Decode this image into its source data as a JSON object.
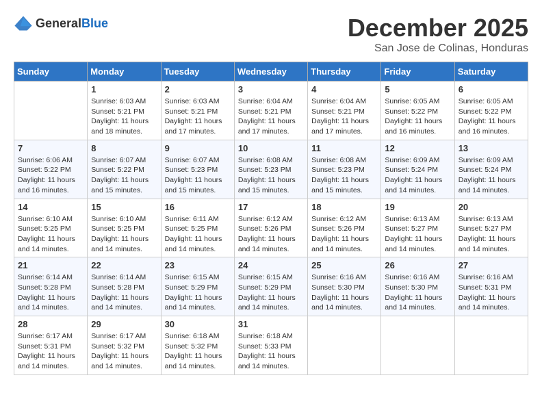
{
  "logo": {
    "general": "General",
    "blue": "Blue"
  },
  "title": "December 2025",
  "location": "San Jose de Colinas, Honduras",
  "days_of_week": [
    "Sunday",
    "Monday",
    "Tuesday",
    "Wednesday",
    "Thursday",
    "Friday",
    "Saturday"
  ],
  "weeks": [
    [
      {
        "day": "",
        "sunrise": "",
        "sunset": "",
        "daylight": ""
      },
      {
        "day": "1",
        "sunrise": "Sunrise: 6:03 AM",
        "sunset": "Sunset: 5:21 PM",
        "daylight": "Daylight: 11 hours and 18 minutes."
      },
      {
        "day": "2",
        "sunrise": "Sunrise: 6:03 AM",
        "sunset": "Sunset: 5:21 PM",
        "daylight": "Daylight: 11 hours and 17 minutes."
      },
      {
        "day": "3",
        "sunrise": "Sunrise: 6:04 AM",
        "sunset": "Sunset: 5:21 PM",
        "daylight": "Daylight: 11 hours and 17 minutes."
      },
      {
        "day": "4",
        "sunrise": "Sunrise: 6:04 AM",
        "sunset": "Sunset: 5:21 PM",
        "daylight": "Daylight: 11 hours and 17 minutes."
      },
      {
        "day": "5",
        "sunrise": "Sunrise: 6:05 AM",
        "sunset": "Sunset: 5:22 PM",
        "daylight": "Daylight: 11 hours and 16 minutes."
      },
      {
        "day": "6",
        "sunrise": "Sunrise: 6:05 AM",
        "sunset": "Sunset: 5:22 PM",
        "daylight": "Daylight: 11 hours and 16 minutes."
      }
    ],
    [
      {
        "day": "7",
        "sunrise": "Sunrise: 6:06 AM",
        "sunset": "Sunset: 5:22 PM",
        "daylight": "Daylight: 11 hours and 16 minutes."
      },
      {
        "day": "8",
        "sunrise": "Sunrise: 6:07 AM",
        "sunset": "Sunset: 5:22 PM",
        "daylight": "Daylight: 11 hours and 15 minutes."
      },
      {
        "day": "9",
        "sunrise": "Sunrise: 6:07 AM",
        "sunset": "Sunset: 5:23 PM",
        "daylight": "Daylight: 11 hours and 15 minutes."
      },
      {
        "day": "10",
        "sunrise": "Sunrise: 6:08 AM",
        "sunset": "Sunset: 5:23 PM",
        "daylight": "Daylight: 11 hours and 15 minutes."
      },
      {
        "day": "11",
        "sunrise": "Sunrise: 6:08 AM",
        "sunset": "Sunset: 5:23 PM",
        "daylight": "Daylight: 11 hours and 15 minutes."
      },
      {
        "day": "12",
        "sunrise": "Sunrise: 6:09 AM",
        "sunset": "Sunset: 5:24 PM",
        "daylight": "Daylight: 11 hours and 14 minutes."
      },
      {
        "day": "13",
        "sunrise": "Sunrise: 6:09 AM",
        "sunset": "Sunset: 5:24 PM",
        "daylight": "Daylight: 11 hours and 14 minutes."
      }
    ],
    [
      {
        "day": "14",
        "sunrise": "Sunrise: 6:10 AM",
        "sunset": "Sunset: 5:25 PM",
        "daylight": "Daylight: 11 hours and 14 minutes."
      },
      {
        "day": "15",
        "sunrise": "Sunrise: 6:10 AM",
        "sunset": "Sunset: 5:25 PM",
        "daylight": "Daylight: 11 hours and 14 minutes."
      },
      {
        "day": "16",
        "sunrise": "Sunrise: 6:11 AM",
        "sunset": "Sunset: 5:25 PM",
        "daylight": "Daylight: 11 hours and 14 minutes."
      },
      {
        "day": "17",
        "sunrise": "Sunrise: 6:12 AM",
        "sunset": "Sunset: 5:26 PM",
        "daylight": "Daylight: 11 hours and 14 minutes."
      },
      {
        "day": "18",
        "sunrise": "Sunrise: 6:12 AM",
        "sunset": "Sunset: 5:26 PM",
        "daylight": "Daylight: 11 hours and 14 minutes."
      },
      {
        "day": "19",
        "sunrise": "Sunrise: 6:13 AM",
        "sunset": "Sunset: 5:27 PM",
        "daylight": "Daylight: 11 hours and 14 minutes."
      },
      {
        "day": "20",
        "sunrise": "Sunrise: 6:13 AM",
        "sunset": "Sunset: 5:27 PM",
        "daylight": "Daylight: 11 hours and 14 minutes."
      }
    ],
    [
      {
        "day": "21",
        "sunrise": "Sunrise: 6:14 AM",
        "sunset": "Sunset: 5:28 PM",
        "daylight": "Daylight: 11 hours and 14 minutes."
      },
      {
        "day": "22",
        "sunrise": "Sunrise: 6:14 AM",
        "sunset": "Sunset: 5:28 PM",
        "daylight": "Daylight: 11 hours and 14 minutes."
      },
      {
        "day": "23",
        "sunrise": "Sunrise: 6:15 AM",
        "sunset": "Sunset: 5:29 PM",
        "daylight": "Daylight: 11 hours and 14 minutes."
      },
      {
        "day": "24",
        "sunrise": "Sunrise: 6:15 AM",
        "sunset": "Sunset: 5:29 PM",
        "daylight": "Daylight: 11 hours and 14 minutes."
      },
      {
        "day": "25",
        "sunrise": "Sunrise: 6:16 AM",
        "sunset": "Sunset: 5:30 PM",
        "daylight": "Daylight: 11 hours and 14 minutes."
      },
      {
        "day": "26",
        "sunrise": "Sunrise: 6:16 AM",
        "sunset": "Sunset: 5:30 PM",
        "daylight": "Daylight: 11 hours and 14 minutes."
      },
      {
        "day": "27",
        "sunrise": "Sunrise: 6:16 AM",
        "sunset": "Sunset: 5:31 PM",
        "daylight": "Daylight: 11 hours and 14 minutes."
      }
    ],
    [
      {
        "day": "28",
        "sunrise": "Sunrise: 6:17 AM",
        "sunset": "Sunset: 5:31 PM",
        "daylight": "Daylight: 11 hours and 14 minutes."
      },
      {
        "day": "29",
        "sunrise": "Sunrise: 6:17 AM",
        "sunset": "Sunset: 5:32 PM",
        "daylight": "Daylight: 11 hours and 14 minutes."
      },
      {
        "day": "30",
        "sunrise": "Sunrise: 6:18 AM",
        "sunset": "Sunset: 5:32 PM",
        "daylight": "Daylight: 11 hours and 14 minutes."
      },
      {
        "day": "31",
        "sunrise": "Sunrise: 6:18 AM",
        "sunset": "Sunset: 5:33 PM",
        "daylight": "Daylight: 11 hours and 14 minutes."
      },
      {
        "day": "",
        "sunrise": "",
        "sunset": "",
        "daylight": ""
      },
      {
        "day": "",
        "sunrise": "",
        "sunset": "",
        "daylight": ""
      },
      {
        "day": "",
        "sunrise": "",
        "sunset": "",
        "daylight": ""
      }
    ]
  ]
}
